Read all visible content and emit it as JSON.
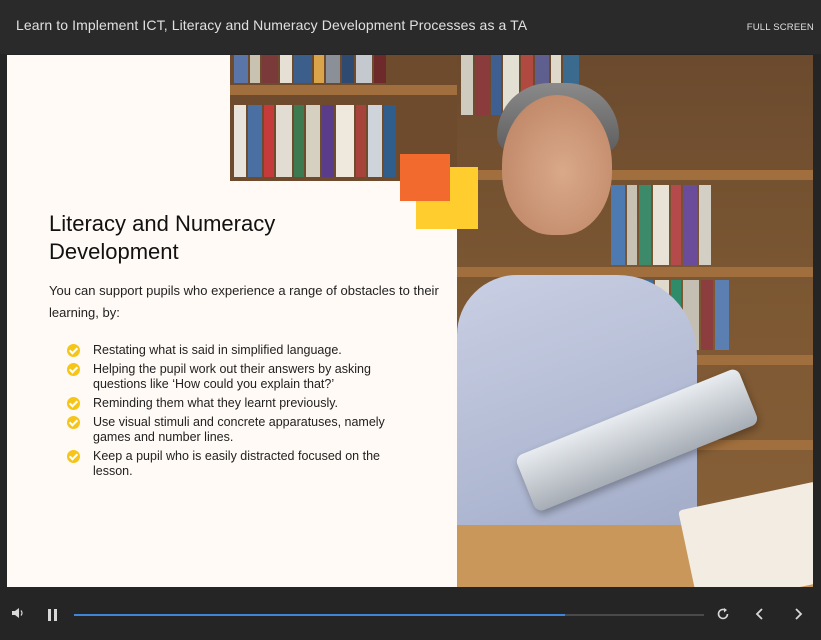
{
  "header": {
    "course_title": "Learn to Implement ICT, Literacy and Numeracy Development Processes as a TA",
    "fullscreen_label": "FULL SCREEN"
  },
  "slide": {
    "heading": "Literacy and Numeracy Development",
    "intro": "You can support pupils who experience a range of obstacles to their learning, by:",
    "bullets": [
      "Restating what is said in simplified language.",
      "Helping the pupil work out their answers by asking questions like ‘How could you explain that?’",
      "Reminding them what they learnt previously.",
      "Use visual stimuli and concrete apparatuses, namely games and number lines.",
      "Keep a pupil who is easily distracted focused on the lesson."
    ],
    "image_icon": "teacher-with-tablet-photo"
  },
  "player": {
    "progress_fraction": 0.78,
    "icons": [
      "volume-icon",
      "pause-icon",
      "replay-icon",
      "prev-icon",
      "next-icon"
    ],
    "accent_color": "#3f86d8"
  },
  "colors": {
    "check_yellow": "#f5c518",
    "deco_orange": "#f26a2e",
    "deco_yellow": "#ffcd2e"
  }
}
